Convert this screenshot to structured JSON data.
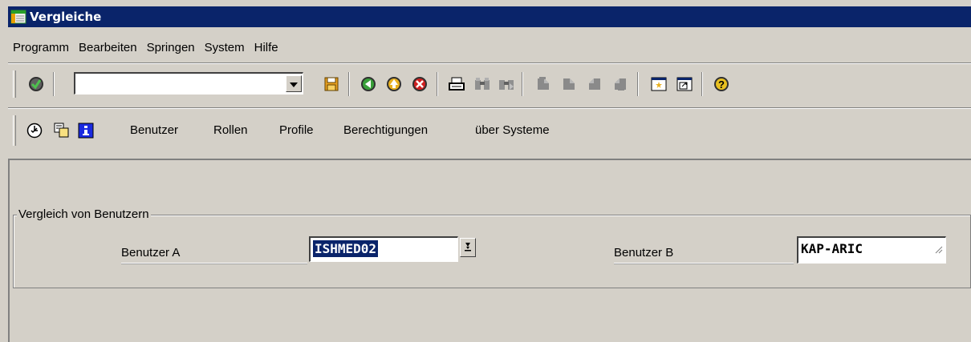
{
  "window": {
    "title": "Vergleiche"
  },
  "menu": [
    "Programm",
    "Bearbeiten",
    "Springen",
    "System",
    "Hilfe"
  ],
  "toolbar": {
    "command_field_value": "",
    "icons": [
      "enter-icon",
      "save-icon",
      "back-icon",
      "exit-icon",
      "cancel-icon",
      "print-icon",
      "find-icon",
      "find-next-icon",
      "first-page-icon",
      "previous-page-icon",
      "next-page-icon",
      "last-page-icon",
      "create-session-icon",
      "shortcut-icon",
      "help-icon"
    ]
  },
  "app_toolbar": {
    "icons": [
      "execute-clock-icon",
      "copy-compare-icon",
      "info-icon"
    ],
    "buttons": [
      "Benutzer",
      "Rollen",
      "Profile",
      "Berechtigungen",
      "über Systeme"
    ]
  },
  "group": {
    "title": "Vergleich von Benutzern",
    "user_a_label": "Benutzer A",
    "user_a_value": "ISHMED02",
    "user_b_label": "Benutzer B",
    "user_b_value": "KAP-ARIC"
  },
  "colors": {
    "title_bar": "#0a246a",
    "background": "#d4d0c8",
    "selection": "#0a246a"
  }
}
